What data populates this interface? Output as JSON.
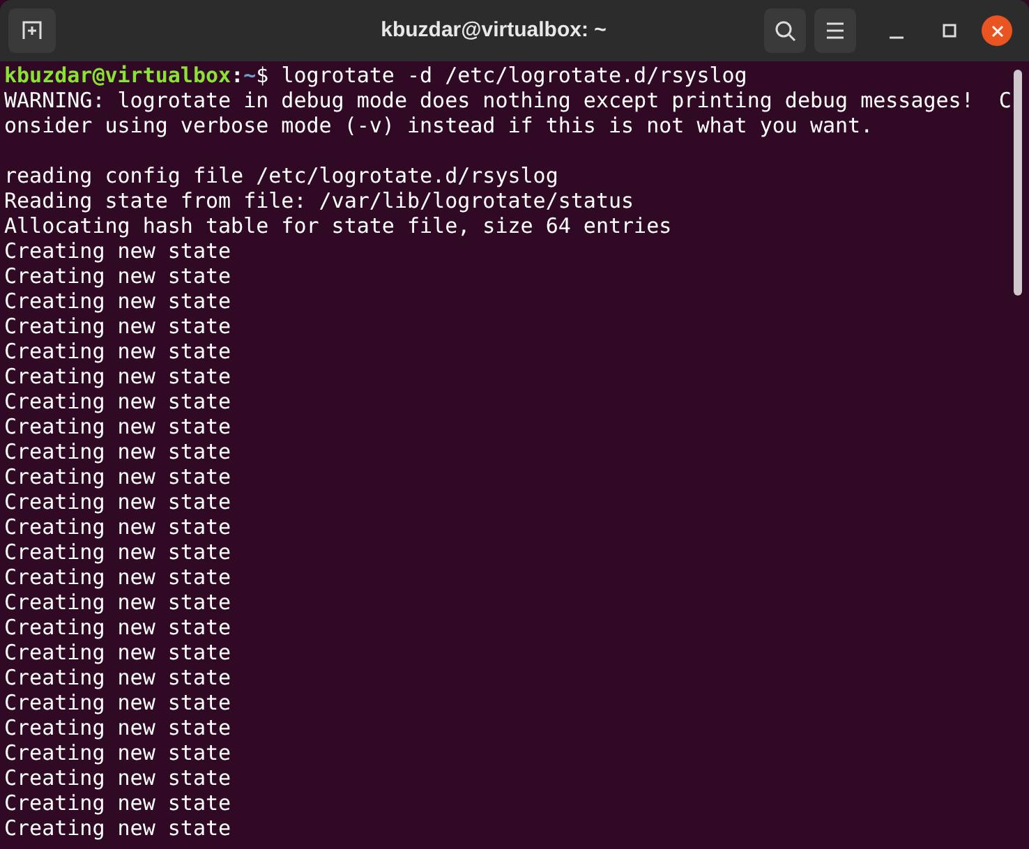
{
  "window": {
    "title": "kbuzdar@virtualbox: ~"
  },
  "prompt": {
    "user_host": "kbuzdar@virtualbox",
    "separator": ":",
    "path": "~",
    "symbol": "$",
    "command": "logrotate -d /etc/logrotate.d/rsyslog"
  },
  "warning_lines": [
    "WARNING: logrotate in debug mode does nothing except printing debug messages!  C",
    "onsider using verbose mode (-v) instead if this is not what you want."
  ],
  "log_lines": [
    "reading config file /etc/logrotate.d/rsyslog",
    "Reading state from file: /var/lib/logrotate/status",
    "Allocating hash table for state file, size 64 entries",
    "Creating new state",
    "Creating new state",
    "Creating new state",
    "Creating new state",
    "Creating new state",
    "Creating new state",
    "Creating new state",
    "Creating new state",
    "Creating new state",
    "Creating new state",
    "Creating new state",
    "Creating new state",
    "Creating new state",
    "Creating new state",
    "Creating new state",
    "Creating new state",
    "Creating new state",
    "Creating new state",
    "Creating new state",
    "Creating new state",
    "Creating new state",
    "Creating new state",
    "Creating new state",
    "Creating new state"
  ]
}
